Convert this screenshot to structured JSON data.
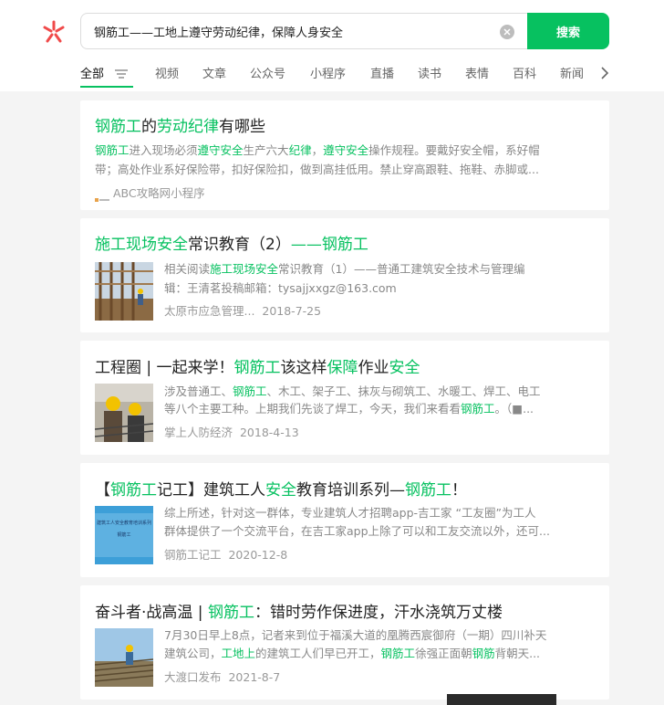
{
  "search": {
    "query": "钢筋工——工地上遵守劳动纪律，保障人身安全",
    "button_label": "搜索"
  },
  "tabs": [
    "全部",
    "视频",
    "文章",
    "公众号",
    "小程序",
    "直播",
    "读书",
    "表情",
    "百科",
    "新闻"
  ],
  "colors": {
    "accent": "#07c160",
    "logo": "#f04a4a"
  },
  "icons": {
    "logo": "asterisk-logo-icon",
    "clear": "clear-icon",
    "filter": "filter-icon",
    "next": "chevron-right-icon"
  },
  "results": [
    {
      "title": [
        "钢筋工",
        "的",
        "劳动纪律",
        "有哪些"
      ],
      "snippet_line1": [
        "钢筋工",
        "进入现场必须",
        "遵守安全",
        "生产六大",
        "纪律",
        "，",
        "遵守安全",
        "操作规程。要戴好安全帽，系好帽"
      ],
      "snippet_line2": "带；高处作业系好保险带，扣好保险扣，做到高挂低用。禁止穿高跟鞋、拖鞋、赤脚或...",
      "source": "ABC攻略网小程序"
    },
    {
      "title": [
        "施工现场安全",
        "常识教育（2）",
        "——钢筋工"
      ],
      "snippet_line1": [
        "相关阅读",
        "施工现场安全",
        "常识教育（1）——普通工建筑安全技术与管理编"
      ],
      "snippet_line2": "辑：王清茗投稿邮箱：tysajjxxgz@163.com",
      "source": "太原市应急管理...",
      "date": "2018-7-25"
    },
    {
      "title": [
        "工程圈 | 一起来学！",
        "钢筋工",
        "该这样",
        "保障",
        "作业",
        "安全"
      ],
      "snippet_line1": [
        "涉及普通工、",
        "钢筋工",
        "、木工、架子工、抹灰与砌筑工、水暖工、焊工、电工"
      ],
      "snippet_line2": [
        "等八个主要工种。上期我们先谈了焊工，今天，我们来看看",
        "钢筋工",
        "。（■..."
      ],
      "source": "掌上人防经济",
      "date": "2018-4-13"
    },
    {
      "title": [
        "【",
        "钢筋工",
        "记工】建筑工人",
        "安全",
        "教育培训系列—",
        "钢筋工",
        "！"
      ],
      "snippet_line1": "综上所述，针对这一群体，专业建筑人才招聘app-吉工家 “工友圈”为工人",
      "snippet_line2": "群体提供了一个交流平台，在吉工家app上除了可以和工友交流以外，还可...",
      "source": "钢筋工记工",
      "date": "2020-12-8",
      "thumb_text": [
        "建筑工人安全教育培训系列",
        "钢筋工"
      ]
    },
    {
      "title": [
        "奋斗者·战高温 | ",
        "钢筋工",
        "：错时劳作保进度，汗水浇筑万丈楼"
      ],
      "snippet_line1": "7月30日早上8点，记者来到位于福溪大道的凰腾西宸御府（一期）四川补天",
      "snippet_line2": [
        "建筑公司，",
        "工地上",
        "的建筑工人们早已开工，",
        "钢筋工",
        "徐强正面朝",
        "钢筋",
        "背朝天..."
      ],
      "source": "大渡口发布",
      "date": "2021-8-7"
    }
  ]
}
